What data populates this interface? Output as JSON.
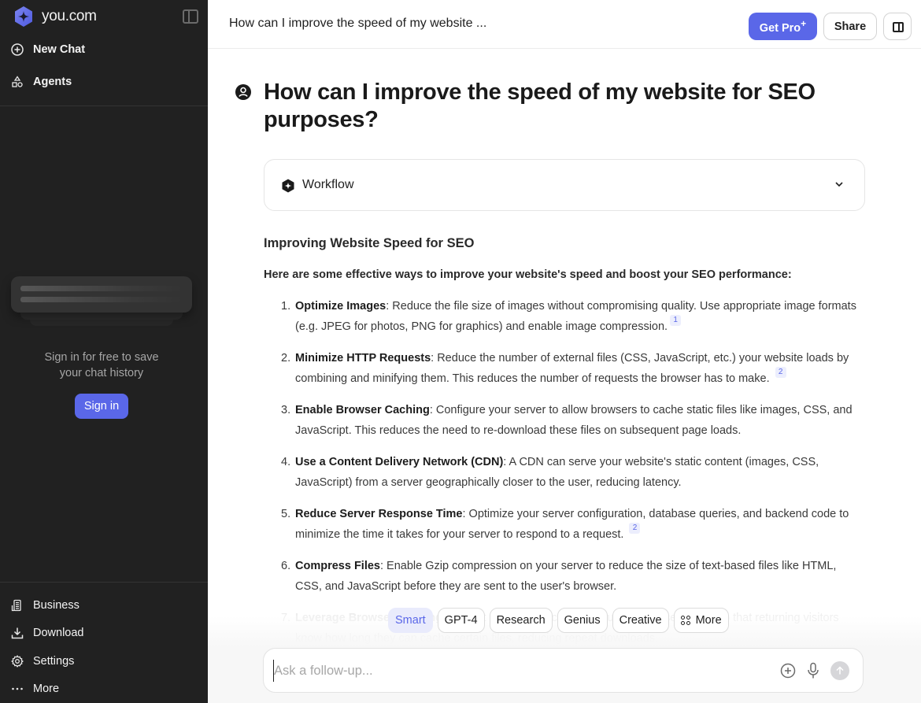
{
  "sidebar": {
    "brand": "you.com",
    "nav_top": [
      {
        "label": "New Chat",
        "icon": "plus-circle-icon"
      },
      {
        "label": "Agents",
        "icon": "shapes-icon"
      }
    ],
    "signin_prompt_line1": "Sign in for free to save",
    "signin_prompt_line2": "your chat history",
    "signin_button": "Sign in",
    "nav_bottom": [
      {
        "label": "Business",
        "icon": "building-icon"
      },
      {
        "label": "Download",
        "icon": "download-icon"
      },
      {
        "label": "Settings",
        "icon": "gear-icon"
      },
      {
        "label": "More",
        "icon": "ellipsis-icon"
      }
    ]
  },
  "header": {
    "chat_title": "How can I improve the speed of my website ...",
    "get_pro_label": "Get Pro",
    "get_pro_mark": "+",
    "share_label": "Share"
  },
  "main": {
    "question": "How can I improve the speed of my website for SEO purposes?",
    "workflow_label": "Workflow",
    "answer_heading": "Improving Website Speed for SEO",
    "answer_intro": "Here are some effective ways to improve your website's speed and boost your SEO performance:",
    "items": [
      {
        "num": "1.",
        "title": "Optimize Images",
        "text": ": Reduce the file size of images without compromising quality. Use appropriate image formats (e.g. JPEG for photos, PNG for graphics) and enable image compression.",
        "cite": "1"
      },
      {
        "num": "2.",
        "title": "Minimize HTTP Requests",
        "text": ": Reduce the number of external files (CSS, JavaScript, etc.) your website loads by combining and minifying them. This reduces the number of requests the browser has to make. ",
        "cite": "2"
      },
      {
        "num": "3.",
        "title": "Enable Browser Caching",
        "text": ": Configure your server to allow browsers to cache static files like images, CSS, and JavaScript. This reduces the need to re-download these files on subsequent page loads.",
        "cite": null
      },
      {
        "num": "4.",
        "title": "Use a Content Delivery Network (CDN)",
        "text": ": A CDN can serve your website's static content (images, CSS, JavaScript) from a server geographically closer to the user, reducing latency.",
        "cite": null
      },
      {
        "num": "5.",
        "title": "Reduce Server Response Time",
        "text": ": Optimize your server configuration, database queries, and backend code to minimize the time it takes for your server to respond to a request. ",
        "cite": "2"
      },
      {
        "num": "6.",
        "title": "Compress Files",
        "text": ": Enable Gzip compression on your server to reduce the size of text-based files like HTML, CSS, and JavaScript before they are sent to the user's browser.",
        "cite": null
      },
      {
        "num": "7.",
        "title": "Leverage Browser Caching",
        "text": ": Instruct browsers to cache resources for a set period so that returning visitors know how long they can cache certain files, reducing repeat downloads.",
        "cite": null
      }
    ]
  },
  "modes": {
    "selected": "Smart",
    "options": [
      "Smart",
      "GPT-4",
      "Research",
      "Genius",
      "Creative",
      "More"
    ]
  },
  "composer": {
    "placeholder": "Ask a follow-up...",
    "value": ""
  },
  "colors": {
    "accent": "#5a67e8",
    "sidebar_bg": "#212121",
    "cite_bg": "#eceefd"
  }
}
